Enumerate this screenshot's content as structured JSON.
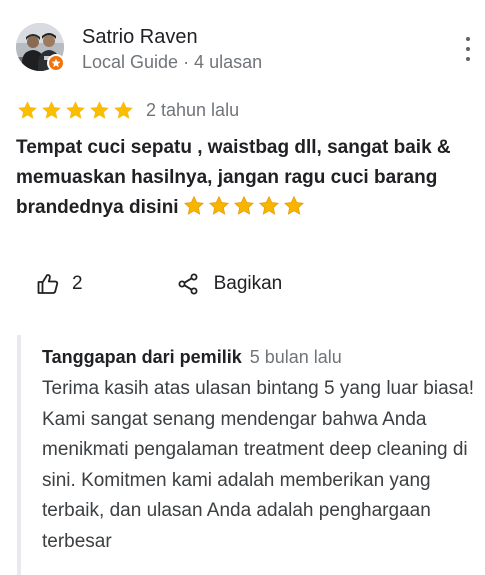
{
  "author": {
    "name": "Satrio Raven",
    "meta": "Local Guide · 4 ulasan"
  },
  "review": {
    "rating": 5,
    "max_rating": 5,
    "date": "2 tahun lalu",
    "text": "Tempat cuci sepatu , waistbag dll, sangat baik & memuaskan hasilnya, jangan ragu cuci barang brandednya disini",
    "emoji_star_count": 5
  },
  "actions": {
    "like_count": "2",
    "share_label": "Bagikan"
  },
  "owner_response": {
    "title": "Tanggapan dari pemilik",
    "date": "5 bulan lalu",
    "text": "Terima kasih atas ulasan bintang 5 yang luar biasa! Kami sangat senang mendengar bahwa Anda menikmati pengalaman treatment deep cleaning di sini. Komitmen kami adalah memberikan yang terbaik, dan ulasan Anda adalah penghargaan terbesar"
  },
  "colors": {
    "star": "#fbbc04",
    "emoji_star": "#f7b500",
    "local_guide_badge": "#f1730a",
    "secondary_text": "#70757a",
    "response_border": "#e8eaed"
  },
  "icons": {
    "more": "more-vert-icon",
    "like": "thumb-up-icon",
    "share": "share-icon",
    "local_guide": "local-guide-badge-icon"
  }
}
